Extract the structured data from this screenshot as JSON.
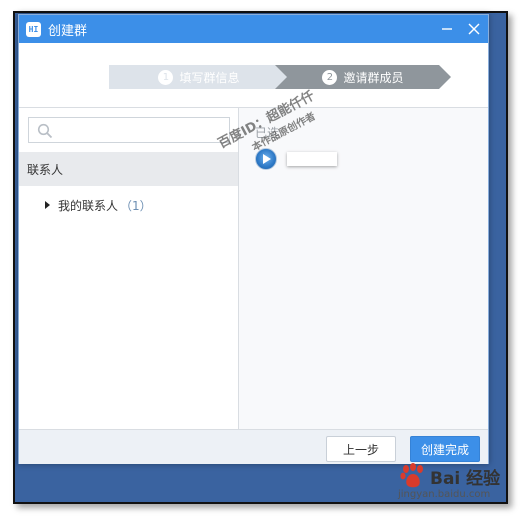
{
  "window": {
    "title": "创建群",
    "app_icon": "HI"
  },
  "steps": [
    {
      "number": "1",
      "label": "填写群信息",
      "state": "done"
    },
    {
      "number": "2",
      "label": "邀请群成员",
      "state": "active"
    }
  ],
  "left_pane": {
    "search": {
      "placeholder": "",
      "value": ""
    },
    "group_header": "联系人",
    "tree": [
      {
        "label": "我的联系人",
        "count": "（1）"
      }
    ]
  },
  "right_pane": {
    "selected_label": "已选",
    "members": [
      {
        "name": ""
      }
    ]
  },
  "watermark": {
    "line1": "百度ID：超能仟仟",
    "line2": "本作品原创作者"
  },
  "footer": {
    "prev_label": "上一步",
    "finish_label": "创建完成"
  },
  "branding": {
    "logo_text": "Bai 经验",
    "url": "jingyan.baidu.com"
  },
  "colors": {
    "accent": "#3c8fe8",
    "step_done": "#dde3ea",
    "step_active": "#8f969c",
    "desktop": "#3a63a0"
  }
}
